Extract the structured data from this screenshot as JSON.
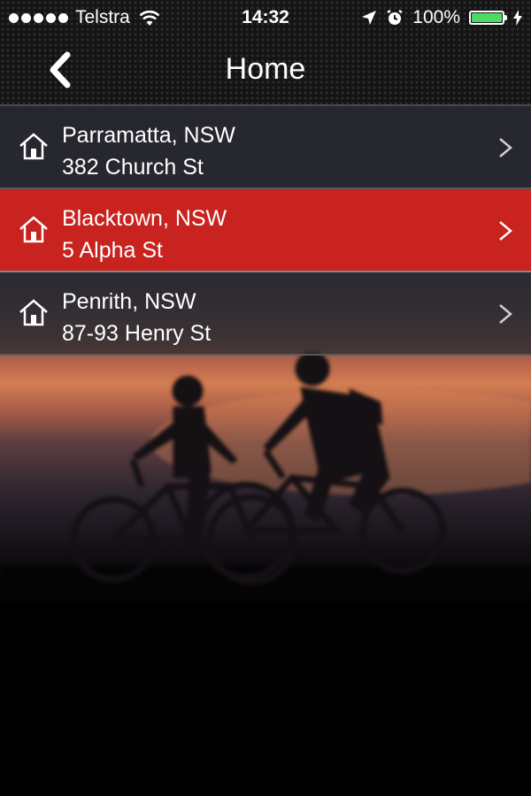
{
  "status_bar": {
    "carrier": "Telstra",
    "time": "14:32",
    "battery": "100%",
    "battery_color": "#4cd964"
  },
  "nav": {
    "title": "Home",
    "back_icon": "chevron-left-icon"
  },
  "locations": [
    {
      "city": "Parramatta, NSW",
      "street": "382 Church St",
      "selected": false
    },
    {
      "city": "Blacktown, NSW",
      "street": "5 Alpha St",
      "selected": true
    },
    {
      "city": "Penrith, NSW",
      "street": "87-93 Henry St",
      "selected": false
    }
  ],
  "colors": {
    "selected_row": "#c8231e",
    "header_bg": "#141414"
  }
}
